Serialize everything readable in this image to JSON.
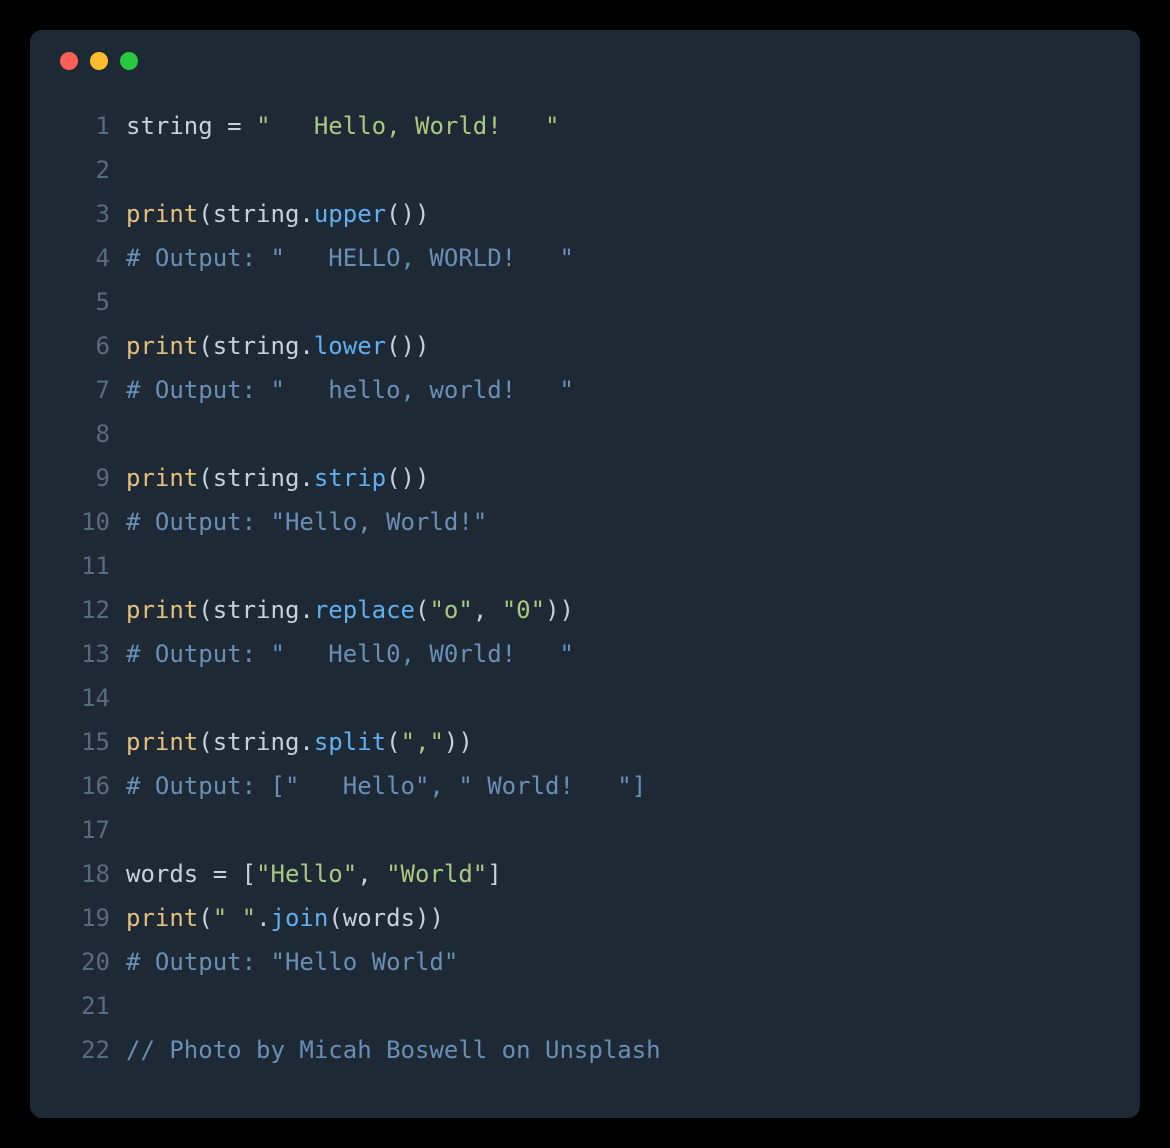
{
  "colors": {
    "window_bg": "#1e2936",
    "line_number": "#5a6b7d",
    "default_text": "#c7d0db",
    "string": "#a8c97f",
    "call": "#e5c07b",
    "method": "#61afef",
    "comment": "#6a8fb5",
    "traffic_red": "#ff5f57",
    "traffic_yellow": "#febc2e",
    "traffic_green": "#28c840"
  },
  "lines": [
    {
      "n": "1",
      "tokens": [
        {
          "cls": "ident",
          "t": "string"
        },
        {
          "cls": "op",
          "t": " = "
        },
        {
          "cls": "str",
          "t": "\"   Hello, World!   \""
        }
      ]
    },
    {
      "n": "2",
      "tokens": []
    },
    {
      "n": "3",
      "tokens": [
        {
          "cls": "call",
          "t": "print"
        },
        {
          "cls": "paren",
          "t": "("
        },
        {
          "cls": "ident",
          "t": "string"
        },
        {
          "cls": "dot-op",
          "t": "."
        },
        {
          "cls": "method",
          "t": "upper"
        },
        {
          "cls": "paren",
          "t": "())"
        }
      ]
    },
    {
      "n": "4",
      "tokens": [
        {
          "cls": "comment",
          "t": "# Output: \"   HELLO, WORLD!   \""
        }
      ]
    },
    {
      "n": "5",
      "tokens": []
    },
    {
      "n": "6",
      "tokens": [
        {
          "cls": "call",
          "t": "print"
        },
        {
          "cls": "paren",
          "t": "("
        },
        {
          "cls": "ident",
          "t": "string"
        },
        {
          "cls": "dot-op",
          "t": "."
        },
        {
          "cls": "method",
          "t": "lower"
        },
        {
          "cls": "paren",
          "t": "())"
        }
      ]
    },
    {
      "n": "7",
      "tokens": [
        {
          "cls": "comment",
          "t": "# Output: \"   hello, world!   \""
        }
      ]
    },
    {
      "n": "8",
      "tokens": []
    },
    {
      "n": "9",
      "tokens": [
        {
          "cls": "call",
          "t": "print"
        },
        {
          "cls": "paren",
          "t": "("
        },
        {
          "cls": "ident",
          "t": "string"
        },
        {
          "cls": "dot-op",
          "t": "."
        },
        {
          "cls": "method",
          "t": "strip"
        },
        {
          "cls": "paren",
          "t": "())"
        }
      ]
    },
    {
      "n": "10",
      "tokens": [
        {
          "cls": "comment",
          "t": "# Output: \"Hello, World!\""
        }
      ]
    },
    {
      "n": "11",
      "tokens": []
    },
    {
      "n": "12",
      "tokens": [
        {
          "cls": "call",
          "t": "print"
        },
        {
          "cls": "paren",
          "t": "("
        },
        {
          "cls": "ident",
          "t": "string"
        },
        {
          "cls": "dot-op",
          "t": "."
        },
        {
          "cls": "method",
          "t": "replace"
        },
        {
          "cls": "paren",
          "t": "("
        },
        {
          "cls": "str",
          "t": "\"o\""
        },
        {
          "cls": "op",
          "t": ", "
        },
        {
          "cls": "str",
          "t": "\"0\""
        },
        {
          "cls": "paren",
          "t": "))"
        }
      ]
    },
    {
      "n": "13",
      "tokens": [
        {
          "cls": "comment",
          "t": "# Output: \"   Hell0, W0rld!   \""
        }
      ]
    },
    {
      "n": "14",
      "tokens": []
    },
    {
      "n": "15",
      "tokens": [
        {
          "cls": "call",
          "t": "print"
        },
        {
          "cls": "paren",
          "t": "("
        },
        {
          "cls": "ident",
          "t": "string"
        },
        {
          "cls": "dot-op",
          "t": "."
        },
        {
          "cls": "method",
          "t": "split"
        },
        {
          "cls": "paren",
          "t": "("
        },
        {
          "cls": "str",
          "t": "\",\""
        },
        {
          "cls": "paren",
          "t": "))"
        }
      ]
    },
    {
      "n": "16",
      "tokens": [
        {
          "cls": "comment",
          "t": "# Output: [\"   Hello\", \" World!   \"]"
        }
      ]
    },
    {
      "n": "17",
      "tokens": []
    },
    {
      "n": "18",
      "tokens": [
        {
          "cls": "ident",
          "t": "words"
        },
        {
          "cls": "op",
          "t": " = ["
        },
        {
          "cls": "str",
          "t": "\"Hello\""
        },
        {
          "cls": "op",
          "t": ", "
        },
        {
          "cls": "str",
          "t": "\"World\""
        },
        {
          "cls": "op",
          "t": "]"
        }
      ]
    },
    {
      "n": "19",
      "tokens": [
        {
          "cls": "call",
          "t": "print"
        },
        {
          "cls": "paren",
          "t": "("
        },
        {
          "cls": "str",
          "t": "\" \""
        },
        {
          "cls": "dot-op",
          "t": "."
        },
        {
          "cls": "method",
          "t": "join"
        },
        {
          "cls": "paren",
          "t": "("
        },
        {
          "cls": "ident",
          "t": "words"
        },
        {
          "cls": "paren",
          "t": "))"
        }
      ]
    },
    {
      "n": "20",
      "tokens": [
        {
          "cls": "comment",
          "t": "# Output: \"Hello World\""
        }
      ]
    },
    {
      "n": "21",
      "tokens": []
    },
    {
      "n": "22",
      "tokens": [
        {
          "cls": "comment",
          "t": "// Photo by Micah Boswell on Unsplash"
        }
      ]
    }
  ]
}
